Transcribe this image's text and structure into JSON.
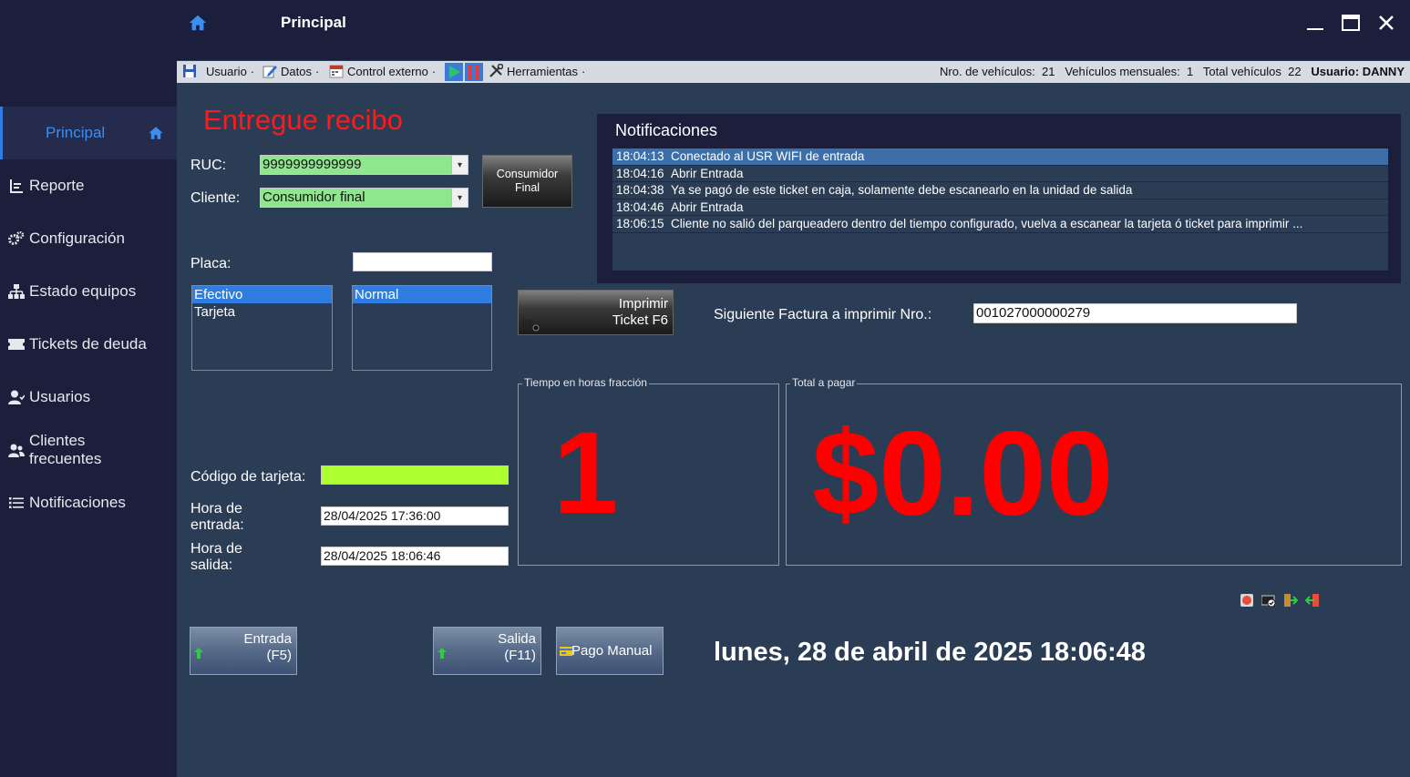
{
  "window": {
    "title": "Principal",
    "minimize_icon": "minimize-icon",
    "maximize_icon": "maximize-icon",
    "close_icon": "close-icon"
  },
  "sidebar": {
    "items": [
      {
        "label": "Principal",
        "icon": "home-icon"
      },
      {
        "label": "Reporte",
        "icon": "report-icon"
      },
      {
        "label": "Configuración",
        "icon": "gears-icon"
      },
      {
        "label": "Estado equipos",
        "icon": "network-icon"
      },
      {
        "label": "Tickets de deuda",
        "icon": "ticket-icon"
      },
      {
        "label": "Usuarios",
        "icon": "user-icon"
      },
      {
        "label": "Clientes frecuentes",
        "icon": "users-icon"
      },
      {
        "label": "Notificaciones",
        "icon": "list-icon"
      }
    ]
  },
  "toolbar": {
    "usuario": "Usuario",
    "datos": "Datos",
    "control_externo": "Control externo",
    "herramientas": "Herramientas",
    "vehiculos_label": "Nro. de vehículos:",
    "vehiculos_value": "21",
    "mensuales_label": "Vehículos mensuales:",
    "mensuales_value": "1",
    "total_label": "Total vehículos",
    "total_value": "22",
    "usuario_label": "Usuario: DANNY"
  },
  "form": {
    "message": "Entregue recibo",
    "ruc_label": "RUC:",
    "ruc_value": "9999999999999",
    "cliente_label": "Cliente:",
    "cliente_value": "Consumidor final",
    "consumidor_button": "Consumidor Final",
    "placa_label": "Placa:",
    "placa_value": "",
    "payment_methods": [
      "Efectivo",
      "Tarjeta"
    ],
    "rate_types": [
      "Normal"
    ],
    "imprimir_line1": "Imprimir",
    "imprimir_line2": "Ticket F6",
    "siguiente_label": "Siguiente Factura a imprimir Nro.:",
    "siguiente_value": "001027000000279",
    "codigo_label": "Código de tarjeta:",
    "codigo_value": "",
    "hora_entrada_label": "Hora de entrada:",
    "hora_entrada_value": "28/04/2025 17:36:00",
    "hora_salida_label": "Hora de salida:",
    "hora_salida_value": "28/04/2025 18:06:46",
    "tiempo_title": "Tiempo en horas fracción",
    "tiempo_value": "1",
    "total_title": "Total a pagar",
    "total_value": "$0.00",
    "entrada_line1": "Entrada",
    "entrada_line2": "(F5)",
    "salida_line1": "Salida",
    "salida_line2": "(F11)",
    "pago_manual": "Pago Manual",
    "datetime": "lunes, 28 de abril de 2025 18:06:48"
  },
  "notifications": {
    "title": "Notificaciones",
    "rows": [
      {
        "time": "18:04:13",
        "text": "Conectado al USR WIFI de entrada"
      },
      {
        "time": "18:04:16",
        "text": "Abrir Entrada"
      },
      {
        "time": "18:04:38",
        "text": "Ya se pagó de este ticket en caja, solamente debe escanearlo en la unidad de salida"
      },
      {
        "time": "18:04:46",
        "text": "Abrir Entrada"
      },
      {
        "time": "18:06:15",
        "text": "Cliente no salió del parqueadero dentro del tiempo configurado, vuelva a escanear la tarjeta ó ticket para imprimir ..."
      }
    ]
  },
  "colors": {
    "accent": "#2f7de1",
    "alert_red": "#ff0000",
    "sidebar_bg": "#1b1f3b",
    "main_bg": "#2b3c55",
    "combo_green": "#8fe68f",
    "card_green": "#adff2f"
  }
}
